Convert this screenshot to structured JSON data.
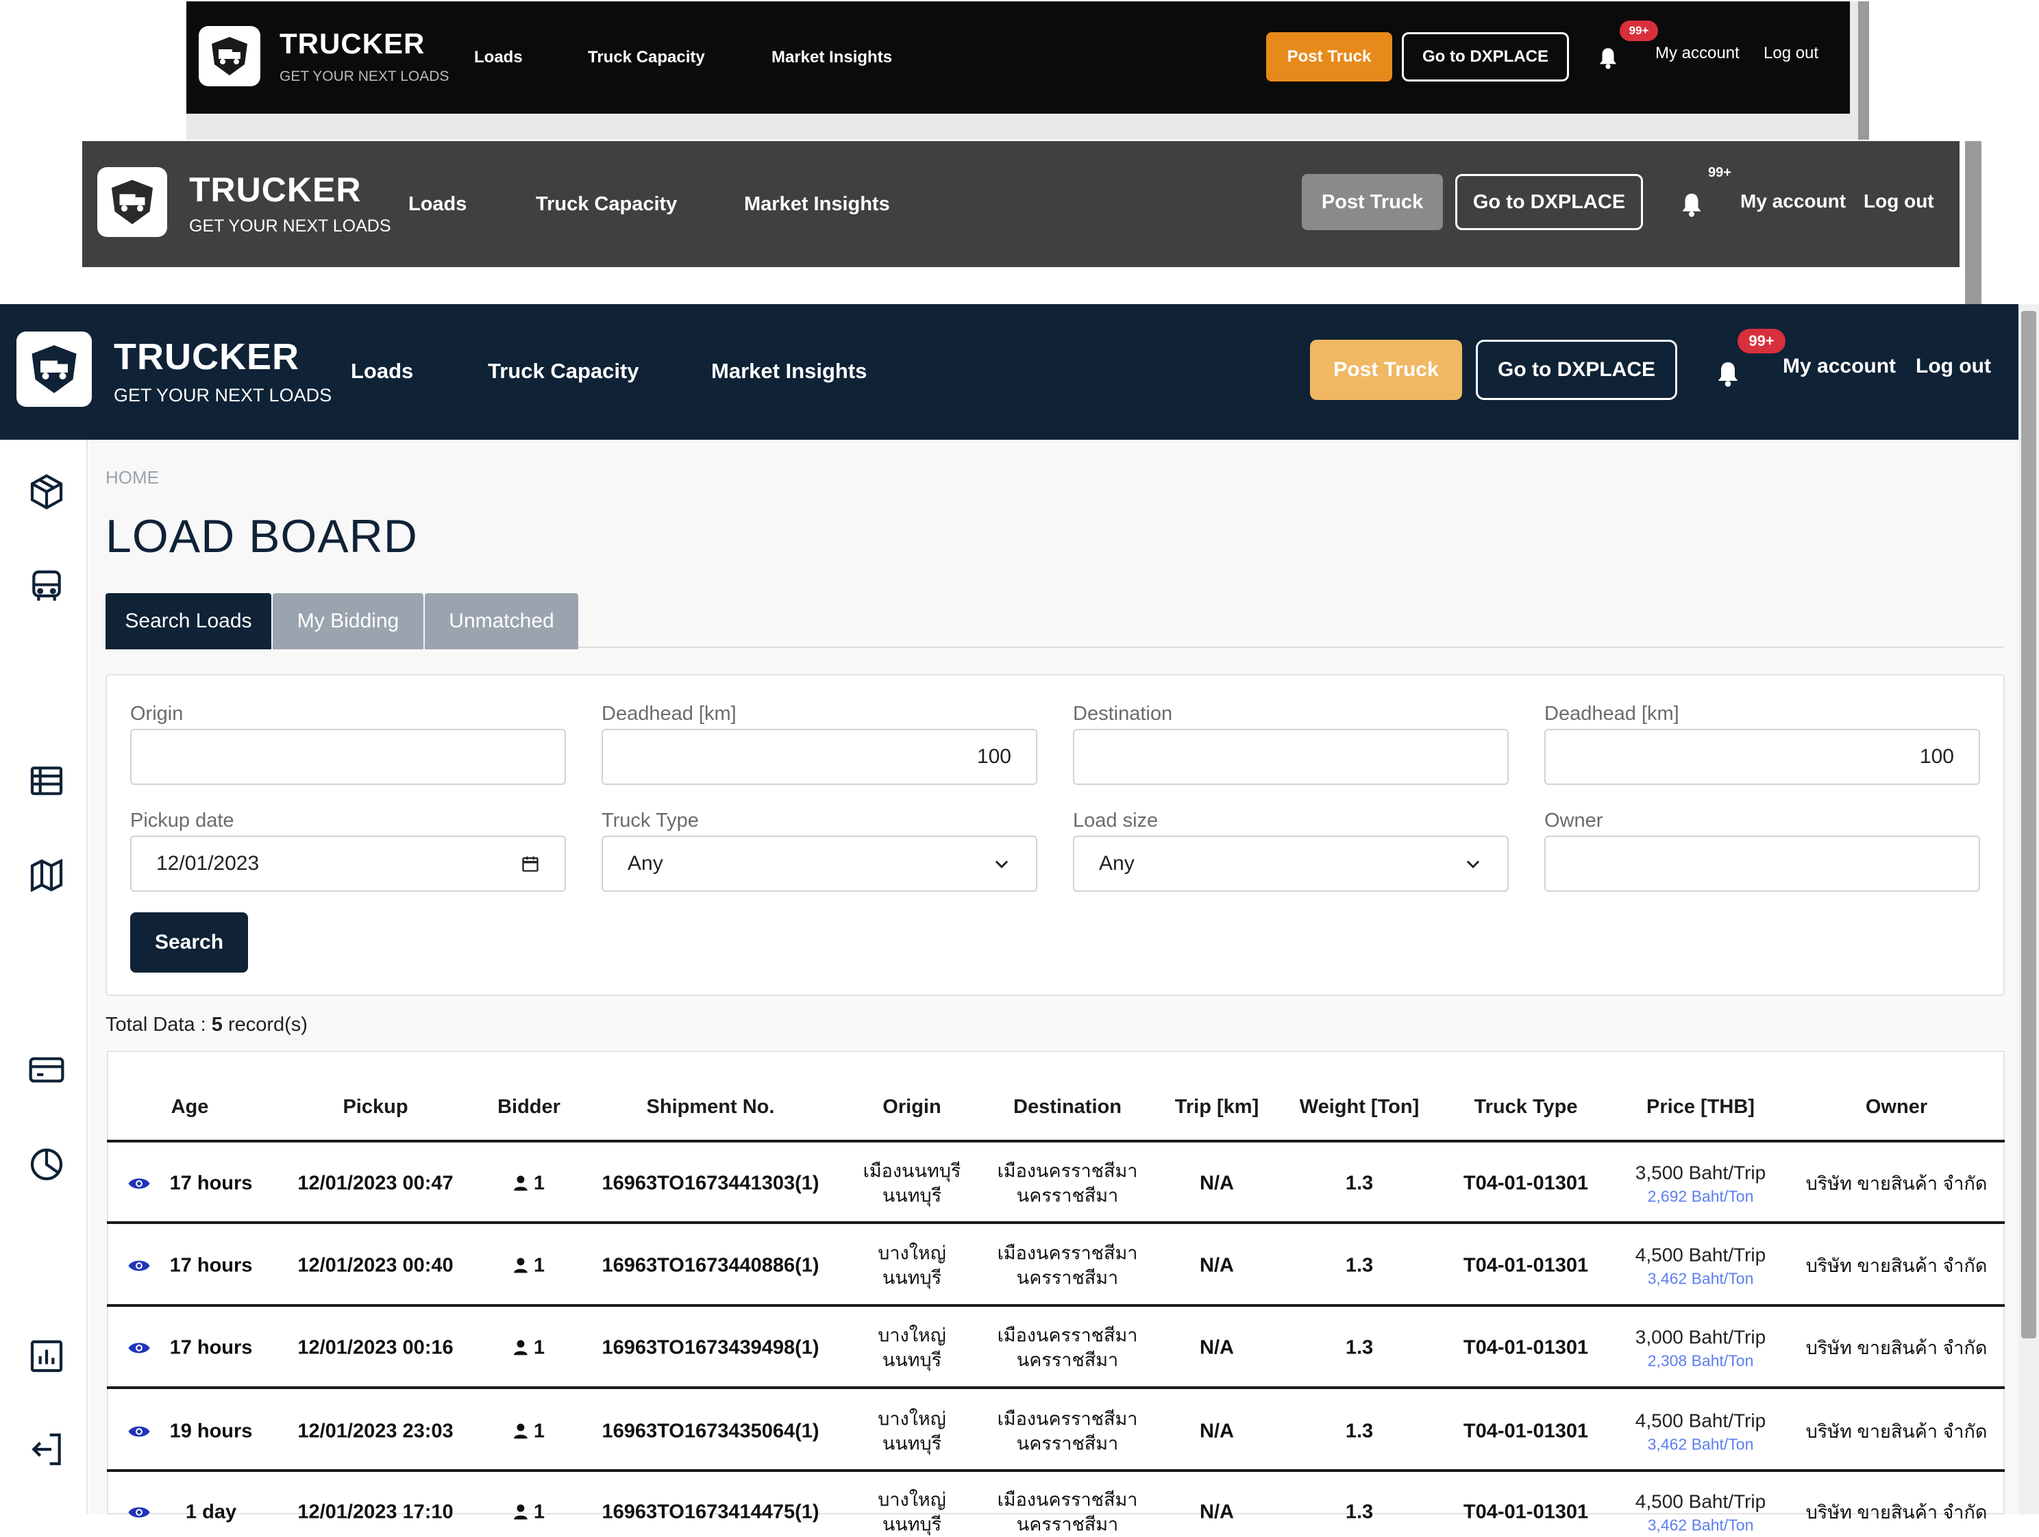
{
  "brand": {
    "title": "TRUCKER",
    "tagline": "GET YOUR NEXT LOADS"
  },
  "nav": {
    "loads": "Loads",
    "truck_capacity": "Truck Capacity",
    "market_insights": "Market Insights"
  },
  "actions": {
    "post_truck": "Post Truck",
    "go_dxplace": "Go to DXPLACE",
    "notif_badge": "99+",
    "my_account": "My account",
    "logout": "Log out"
  },
  "colors": {
    "navy": "#0f2236",
    "black": "#0b0b0b",
    "darkgray": "#404040",
    "orange": "#e78a1b",
    "orange_light": "#f0b863",
    "gray_button": "#8a8a8a",
    "badge_red": "#d8303c",
    "price_blue": "#5b7ef0"
  },
  "breadcrumb": "HOME",
  "page_title": "LOAD BOARD",
  "tabs": {
    "search_loads": "Search Loads",
    "my_bidding": "My Bidding",
    "unmatched": "Unmatched"
  },
  "form": {
    "origin_label": "Origin",
    "origin_value": "",
    "deadhead1_label": "Deadhead [km]",
    "deadhead1_value": "100",
    "destination_label": "Destination",
    "destination_value": "",
    "deadhead2_label": "Deadhead [km]",
    "deadhead2_value": "100",
    "pickup_label": "Pickup date",
    "pickup_value": "12/01/2023",
    "truck_type_label": "Truck Type",
    "truck_type_value": "Any",
    "load_size_label": "Load size",
    "load_size_value": "Any",
    "owner_label": "Owner",
    "owner_value": "",
    "search_button": "Search"
  },
  "total": {
    "prefix": "Total Data :",
    "count": "5",
    "suffix": "record(s)"
  },
  "table": {
    "headers": [
      "Age",
      "Pickup",
      "Bidder",
      "Shipment No.",
      "Origin",
      "Destination",
      "Trip [km]",
      "Weight [Ton]",
      "Truck Type",
      "Price [THB]",
      "Owner"
    ],
    "rows": [
      {
        "age": "17 hours",
        "pickup": "12/01/2023 00:47",
        "bidder": "1",
        "shipment": "16963TO1673441303(1)",
        "origin1": "เมืองนนทบุรี",
        "origin2": "นนทบุรี",
        "dest1": "เมืองนครราชสีมา",
        "dest2": "นครราชสีมา",
        "trip": "N/A",
        "weight": "1.3",
        "truck": "T04-01-01301",
        "price": "3,500 Baht/Trip",
        "price_sub": "2,692 Baht/Ton",
        "owner": "บริษัท ขายสินค้า จำกัด"
      },
      {
        "age": "17 hours",
        "pickup": "12/01/2023 00:40",
        "bidder": "1",
        "shipment": "16963TO1673440886(1)",
        "origin1": "บางใหญ่",
        "origin2": "นนทบุรี",
        "dest1": "เมืองนครราชสีมา",
        "dest2": "นครราชสีมา",
        "trip": "N/A",
        "weight": "1.3",
        "truck": "T04-01-01301",
        "price": "4,500 Baht/Trip",
        "price_sub": "3,462 Baht/Ton",
        "owner": "บริษัท ขายสินค้า จำกัด"
      },
      {
        "age": "17 hours",
        "pickup": "12/01/2023 00:16",
        "bidder": "1",
        "shipment": "16963TO1673439498(1)",
        "origin1": "บางใหญ่",
        "origin2": "นนทบุรี",
        "dest1": "เมืองนครราชสีมา",
        "dest2": "นครราชสีมา",
        "trip": "N/A",
        "weight": "1.3",
        "truck": "T04-01-01301",
        "price": "3,000 Baht/Trip",
        "price_sub": "2,308 Baht/Ton",
        "owner": "บริษัท ขายสินค้า จำกัด"
      },
      {
        "age": "19 hours",
        "pickup": "12/01/2023 23:03",
        "bidder": "1",
        "shipment": "16963TO1673435064(1)",
        "origin1": "บางใหญ่",
        "origin2": "นนทบุรี",
        "dest1": "เมืองนครราชสีมา",
        "dest2": "นครราชสีมา",
        "trip": "N/A",
        "weight": "1.3",
        "truck": "T04-01-01301",
        "price": "4,500 Baht/Trip",
        "price_sub": "3,462 Baht/Ton",
        "owner": "บริษัท ขายสินค้า จำกัด"
      },
      {
        "age": "1 day",
        "pickup": "12/01/2023 17:10",
        "bidder": "1",
        "shipment": "16963TO1673414475(1)",
        "origin1": "บางใหญ่",
        "origin2": "นนทบุรี",
        "dest1": "เมืองนครราชสีมา",
        "dest2": "นครราชสีมา",
        "trip": "N/A",
        "weight": "1.3",
        "truck": "T04-01-01301",
        "price": "4,500 Baht/Trip",
        "price_sub": "3,462 Baht/Ton",
        "owner": "บริษัท ขายสินค้า จำกัด"
      }
    ]
  }
}
